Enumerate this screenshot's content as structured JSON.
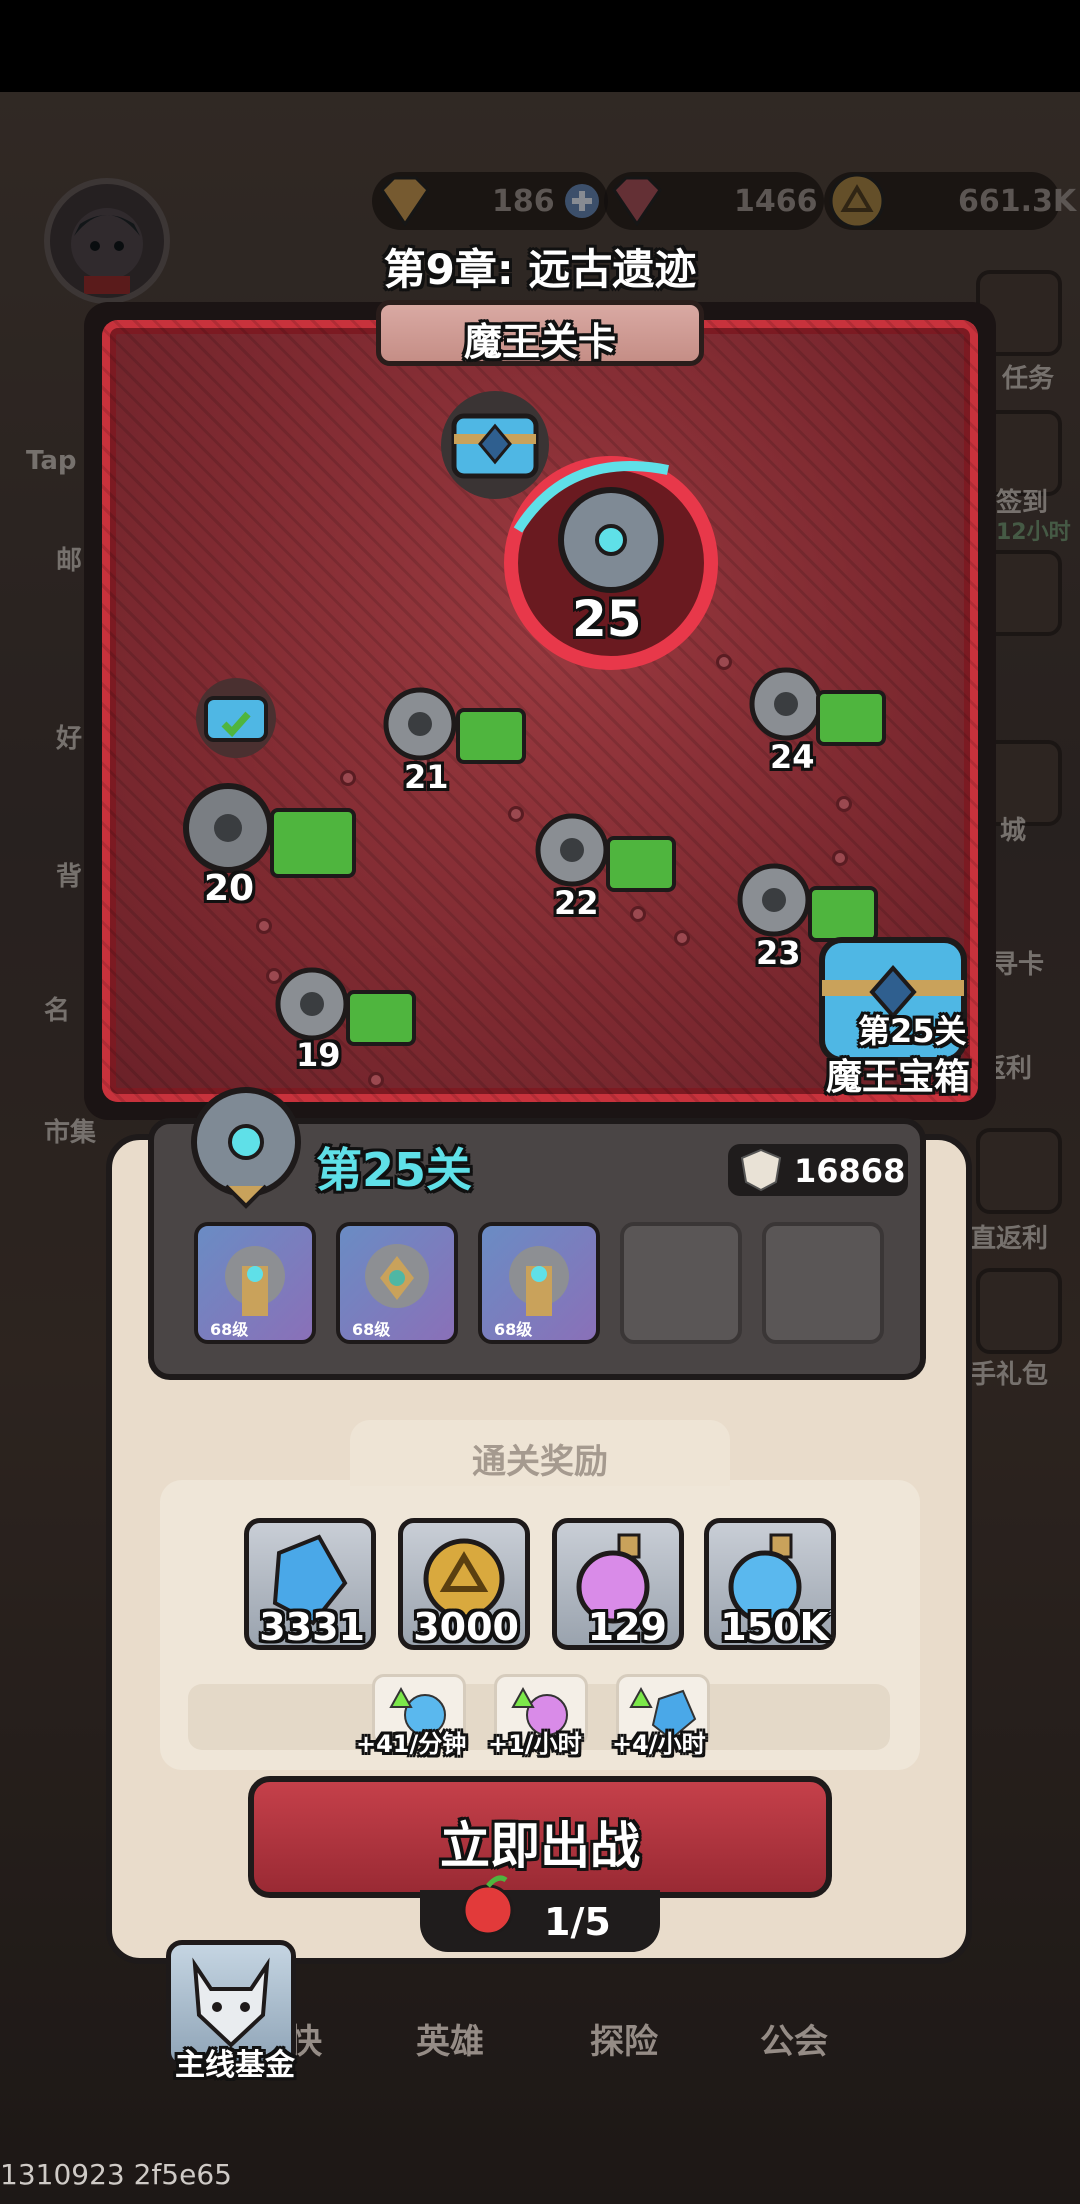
{
  "resources": {
    "diamond": "186",
    "ruby": "1466",
    "coin": "661.3K"
  },
  "side_menu": {
    "task": "任务",
    "checkin": "签到",
    "checkin_timer": "12小时",
    "shop": "城",
    "card": "寻卡",
    "rebate": "返利",
    "direct_rebate": "直返利",
    "newbie_pack": "手礼包",
    "left_tap": "Tap",
    "left_mail": "邮",
    "left_friend": "好",
    "left_bag": "背",
    "left_name": "名",
    "left_market": "市集"
  },
  "chapter": {
    "title": "第9章: 远古遗迹",
    "banner": "魔王关卡",
    "boss_level": "25",
    "nodes": [
      "19",
      "20",
      "21",
      "22",
      "23",
      "24"
    ],
    "chest_label_line1": "第25关",
    "chest_label_line2": "魔王宝箱"
  },
  "level_panel": {
    "title": "第25关",
    "power": "16868",
    "enemies": [
      {
        "level": "68级"
      },
      {
        "level": "68级"
      },
      {
        "level": "68级"
      }
    ],
    "reward_title": "通关奖励",
    "rewards": [
      {
        "icon": "crystal-icon",
        "count": "3331"
      },
      {
        "icon": "coin-icon",
        "count": "3000"
      },
      {
        "icon": "purple-potion-icon",
        "count": "129"
      },
      {
        "icon": "blue-potion-icon",
        "count": "150K"
      }
    ],
    "rates": [
      {
        "icon": "blue-potion-up-icon",
        "text": "+41/分钟"
      },
      {
        "icon": "purple-potion-up-icon",
        "text": "+1/小时"
      },
      {
        "icon": "crystal-up-icon",
        "text": "+4/小时"
      }
    ],
    "battle_button": "立即出战",
    "stamina": "1/5"
  },
  "bottom_nav": {
    "fund": "主线基金",
    "item2": "快",
    "heroes": "英雄",
    "explore": "探险",
    "guild": "公会"
  },
  "debug": "1310923 2f5e65",
  "colors": {
    "accent_cyan": "#5fe0e8",
    "boss_red": "#c8323c",
    "complete_green": "#4fb53e"
  }
}
